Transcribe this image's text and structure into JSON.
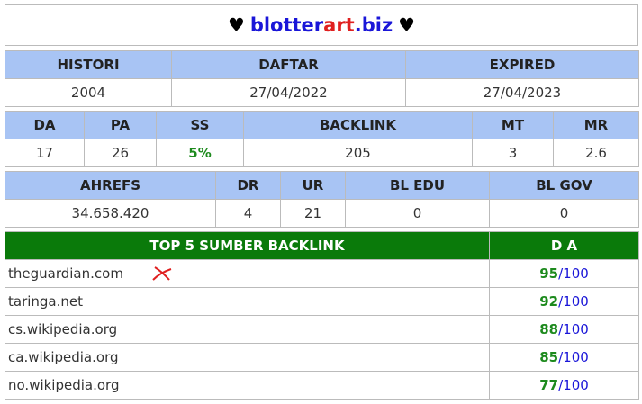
{
  "header": {
    "heart_left": "♥",
    "name_part1": "blotter",
    "name_part2": "art",
    "name_part3": ".biz",
    "heart_right": "♥"
  },
  "row1": {
    "headers": [
      "HISTORI",
      "DAFTAR",
      "EXPIRED"
    ],
    "values": [
      "2004",
      "27/04/2022",
      "27/04/2023"
    ]
  },
  "row2": {
    "headers": [
      "DA",
      "PA",
      "SS",
      "BACKLINK",
      "MT",
      "MR"
    ],
    "values": [
      "17",
      "26",
      "5%",
      "205",
      "3",
      "2.6"
    ]
  },
  "row3": {
    "headers": [
      "AHREFS",
      "DR",
      "UR",
      "BL EDU",
      "BL GOV"
    ],
    "values": [
      "34.658.420",
      "4",
      "21",
      "0",
      "0"
    ]
  },
  "backlinks": {
    "header_site": "TOP 5 SUMBER BACKLINK",
    "header_da": "D A",
    "max": "/100",
    "rows": [
      {
        "site": "theguardian.com",
        "da": "95"
      },
      {
        "site": "taringa.net",
        "da": "92"
      },
      {
        "site": "cs.wikipedia.org",
        "da": "88"
      },
      {
        "site": "ca.wikipedia.org",
        "da": "85"
      },
      {
        "site": "no.wikipedia.org",
        "da": "77"
      }
    ]
  },
  "colors": {
    "header_bg": "#a8c4f4",
    "top5_header_bg": "#0a7a0a",
    "brand_blue": "#1a16d8",
    "brand_red": "#e02020",
    "green": "#1d8a1d"
  }
}
